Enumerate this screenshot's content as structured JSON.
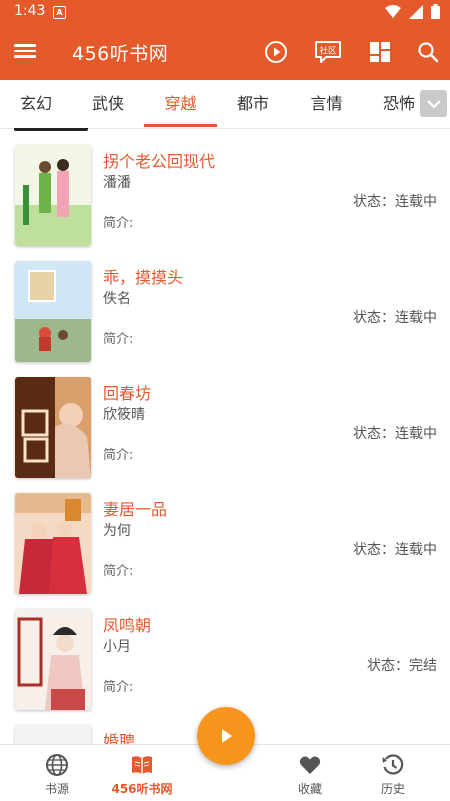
{
  "status_bar": {
    "time": "1:43",
    "notification_icon": "A"
  },
  "app_bar": {
    "title": "456听书网",
    "community_label": "社区"
  },
  "tabs": [
    {
      "label": "玄幻"
    },
    {
      "label": "武侠"
    },
    {
      "label": "穿越",
      "active": true
    },
    {
      "label": "都市"
    },
    {
      "label": "言情"
    },
    {
      "label": "恐怖"
    }
  ],
  "books": [
    {
      "title": "拐个老公回现代",
      "author": "潘潘",
      "intro_label": "简介:",
      "status": "状态：连载中"
    },
    {
      "title": "乖，摸摸头",
      "author": "佚名",
      "intro_label": "简介:",
      "status": "状态：连载中"
    },
    {
      "title": "回春坊",
      "author": "欣筱晴",
      "intro_label": "简介:",
      "status": "状态：连载中"
    },
    {
      "title": "妻居一品",
      "author": "为何",
      "intro_label": "简介:",
      "status": "状态：连载中"
    },
    {
      "title": "凤鸣朝",
      "author": "小月",
      "intro_label": "简介:",
      "status": "状态：完结"
    },
    {
      "title": "婚聘"
    }
  ],
  "bottom_nav": [
    {
      "label": "书源",
      "icon": "globe-icon"
    },
    {
      "label": "456听书网",
      "icon": "book-icon",
      "active": true
    },
    {
      "label": "收藏",
      "icon": "heart-icon"
    },
    {
      "label": "历史",
      "icon": "history-icon"
    }
  ],
  "colors": {
    "primary": "#e45a2b",
    "fab": "#f7951d",
    "tab_more": "#c9c9c9"
  }
}
